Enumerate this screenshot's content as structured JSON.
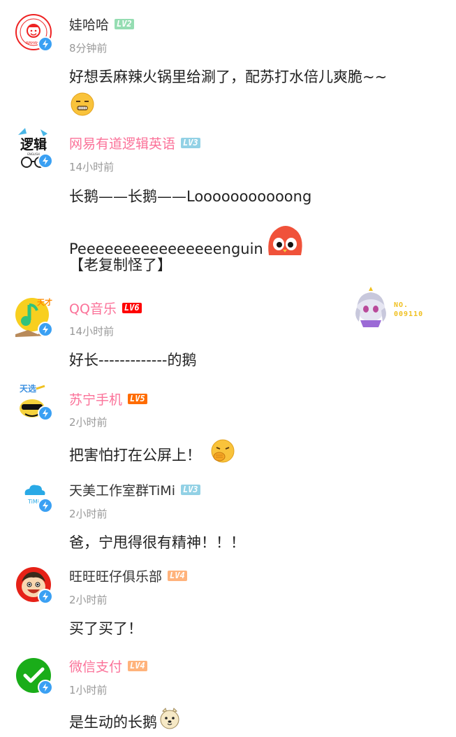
{
  "comments": [
    {
      "user": "娃哈哈",
      "level": "LV2",
      "time": "8分钟前",
      "text": "好想丢麻辣火锅里给涮了，配苏打水倍儿爽脆~~"
    },
    {
      "user": "网易有道逻辑英语",
      "level": "LV3",
      "time": "14小时前",
      "text": "长鹅——长鹅——Looooooooooong",
      "text2": "Peeeeeeeeeeeeeeeenguin",
      "text3": "【老复制怪了】"
    },
    {
      "user": "QQ音乐",
      "level": "LV6",
      "time": "14小时前",
      "text": "好长-------------的鹅",
      "fan_label": "NO.",
      "fan_number": "009110"
    },
    {
      "user": "苏宁手机",
      "level": "LV5",
      "time": "2小时前",
      "text": "把害怕打在公屏上！"
    },
    {
      "user": "天美工作室群TiMi",
      "level": "LV3",
      "time": "2小时前",
      "text": "爸，宁甩得很有精神！！！"
    },
    {
      "user": "旺旺旺仔俱乐部",
      "level": "LV4",
      "time": "2小时前",
      "text": "买了买了！"
    },
    {
      "user": "微信支付",
      "level": "LV4",
      "time": "1小时前",
      "text": "是生动的长鹅"
    }
  ],
  "level_colors": {
    "LV2": "#95ddb2",
    "LV3": "#92d1e5",
    "LV4": "#ffb37c",
    "LV5": "#ff6c00",
    "LV6": "#ff0000"
  },
  "accent_color": "#fb7299",
  "avatar_texts": {
    "wahaha": "WAHAHA",
    "youdao": "逻辑",
    "youdao_sub": "ENGLISH",
    "qq": "天才",
    "suning": "天选",
    "timi": "TiMi"
  },
  "icons": [
    "wahaha-logo",
    "youdao-logo",
    "qq-music-logo",
    "suning-logo",
    "timi-logo",
    "wangwang-logo",
    "wechat-pay-logo",
    "verified-icon"
  ]
}
